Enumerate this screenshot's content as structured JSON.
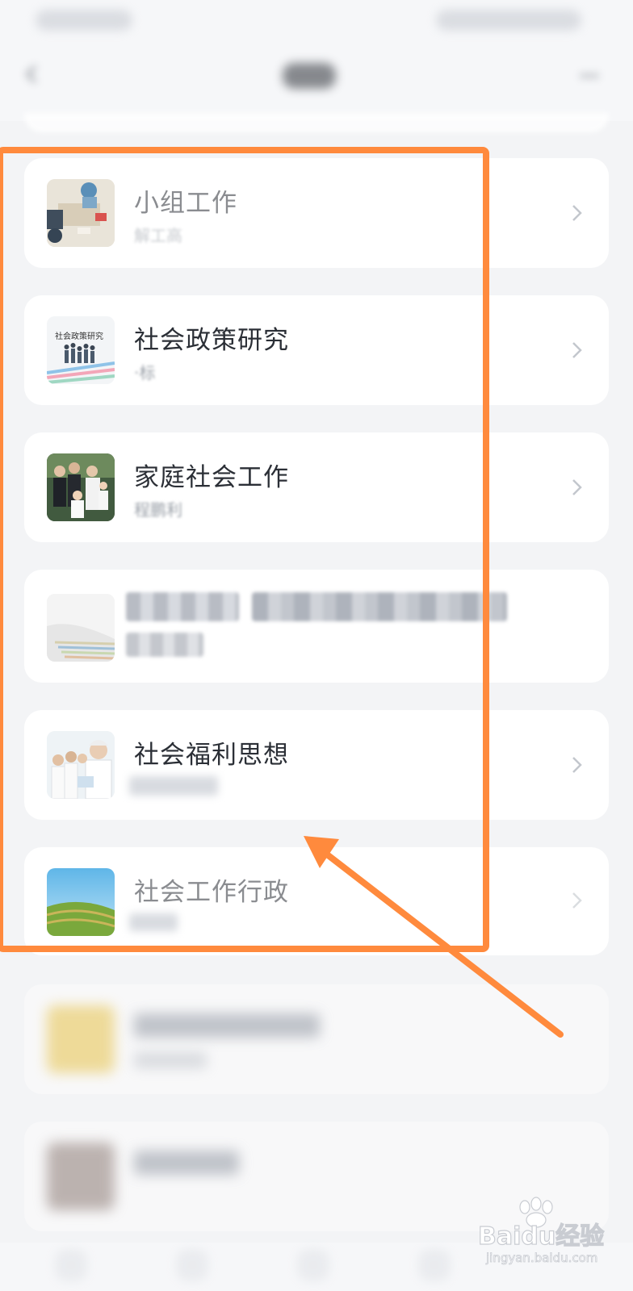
{
  "list": {
    "items": [
      {
        "title": "小组工作",
        "subtitle": "解工高"
      },
      {
        "title": "社会政策研究",
        "subtitle": "·标",
        "thumb_label": "社会政策研究"
      },
      {
        "title": "家庭社会工作",
        "subtitle": "程鹏利"
      },
      {
        "title": "",
        "subtitle": ""
      },
      {
        "title": "社会福利思想",
        "subtitle": ""
      },
      {
        "title": "社会工作行政",
        "subtitle": ""
      }
    ]
  },
  "watermark": {
    "brand": "Baidu经验",
    "url": "jingyan.baidu.com"
  },
  "colors": {
    "highlight": "#ff8a3d",
    "card": "#ffffff",
    "background": "#f3f4f6",
    "title": "#2b2f36"
  }
}
